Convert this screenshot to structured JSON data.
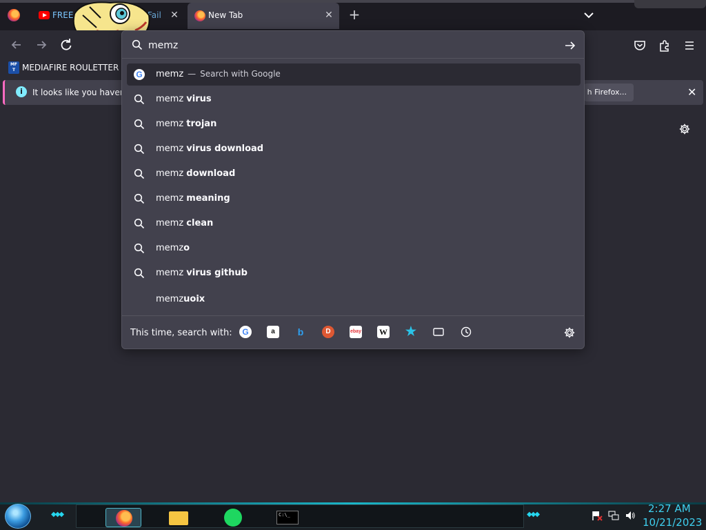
{
  "tabs": [
    {
      "label": "FREE",
      "active": false
    },
    {
      "label": "Fail",
      "active": false
    },
    {
      "label": "New Tab",
      "active": true
    }
  ],
  "bookmarks": {
    "label": "MEDIAFIRE ROULETTER",
    "icon_text": "MF T"
  },
  "infobar": {
    "text": "It looks like you haven't s",
    "button_label": "h Firefox..."
  },
  "urlbar": {
    "value": "memz"
  },
  "suggestions": [
    {
      "icon": "google-icon",
      "prefix": "memz",
      "bold": "",
      "sep": "—",
      "action": "Search with Google",
      "selected": true
    },
    {
      "icon": "search-icon",
      "prefix": "memz ",
      "bold": "virus"
    },
    {
      "icon": "search-icon",
      "prefix": "memz ",
      "bold": "trojan"
    },
    {
      "icon": "search-icon",
      "prefix": "memz ",
      "bold": "virus download"
    },
    {
      "icon": "search-icon",
      "prefix": "memz ",
      "bold": "download"
    },
    {
      "icon": "search-icon",
      "prefix": "memz ",
      "bold": "meaning"
    },
    {
      "icon": "search-icon",
      "prefix": "memz ",
      "bold": "clean"
    },
    {
      "icon": "search-icon",
      "prefix": "memz",
      "bold": "o"
    },
    {
      "icon": "search-icon",
      "prefix": "memz ",
      "bold": "virus github"
    },
    {
      "icon": "",
      "prefix": "memz",
      "bold": "uoix"
    }
  ],
  "oneoff": {
    "label": "This time, search with:",
    "engines": [
      "google-icon",
      "amazon-icon",
      "bing-icon",
      "duckduckgo-icon",
      "ebay-icon",
      "wikipedia-icon",
      "bookmarks-star-icon",
      "tabs-icon",
      "history-icon"
    ],
    "engine_glyphs": {
      "g": "G",
      "a": "a",
      "b": "b",
      "ddg": "D",
      "ebay": "ebay",
      "w": "W"
    }
  },
  "taskbar": {
    "time": "2:27 AM",
    "date": "10/21/2023",
    "apps": [
      "firefox-icon",
      "file-explorer-icon",
      "spotify-icon",
      "terminal-icon"
    ],
    "terminal_glyph": "C:\\_"
  },
  "colors": {
    "accent": "#80ebff",
    "panel": "#42414d",
    "bg": "#2b2a33",
    "taskbar_text": "#3fd0f0"
  }
}
